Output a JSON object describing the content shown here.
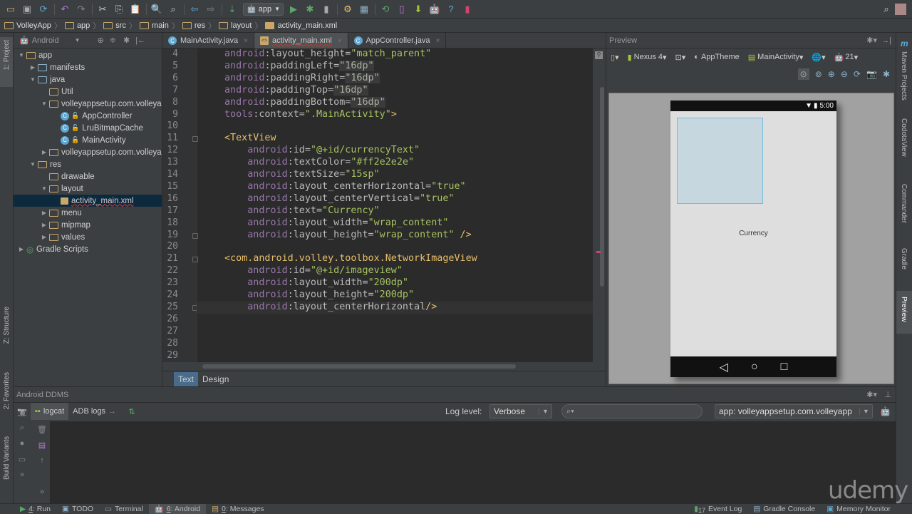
{
  "toolbar": {
    "run_config": "app",
    "icons": [
      "open-folder-icon",
      "save-icon",
      "sync-icon",
      "undo-icon",
      "redo-icon",
      "cut-icon",
      "copy-icon",
      "paste-icon",
      "find-icon",
      "replace-icon",
      "back-icon",
      "forward-icon",
      "make-project-icon",
      "run-icon",
      "debug-icon",
      "attach-debugger-icon",
      "project-structure-icon",
      "sdk-manager-icon",
      "sync-gradle-icon",
      "avd-manager-icon",
      "sdk-android-icon",
      "android-monitor-icon",
      "help-icon",
      "device-monitor-icon"
    ]
  },
  "breadcrumb": [
    "VolleyApp",
    "app",
    "src",
    "main",
    "res",
    "layout",
    "activity_main.xml"
  ],
  "project": {
    "view_mode": "Android",
    "tree": [
      {
        "label": "app",
        "depth": 0,
        "arrow": "▼",
        "icon": "module"
      },
      {
        "label": "manifests",
        "depth": 1,
        "arrow": "▶",
        "icon": "folder"
      },
      {
        "label": "java",
        "depth": 1,
        "arrow": "▼",
        "icon": "folder"
      },
      {
        "label": "Util",
        "depth": 2,
        "arrow": "",
        "icon": "package"
      },
      {
        "label": "volleyappsetup.com.volleya",
        "depth": 2,
        "arrow": "▼",
        "icon": "package"
      },
      {
        "label": "AppController",
        "depth": 3,
        "arrow": "",
        "icon": "class"
      },
      {
        "label": "LruBitmapCache",
        "depth": 3,
        "arrow": "",
        "icon": "class"
      },
      {
        "label": "MainActivity",
        "depth": 3,
        "arrow": "",
        "icon": "class"
      },
      {
        "label": "volleyappsetup.com.volleya",
        "depth": 2,
        "arrow": "▶",
        "icon": "package"
      },
      {
        "label": "res",
        "depth": 1,
        "arrow": "▼",
        "icon": "res"
      },
      {
        "label": "drawable",
        "depth": 2,
        "arrow": "",
        "icon": "package"
      },
      {
        "label": "layout",
        "depth": 2,
        "arrow": "▼",
        "icon": "package"
      },
      {
        "label": "activity_main.xml",
        "depth": 3,
        "arrow": "",
        "icon": "xml",
        "selected": true
      },
      {
        "label": "menu",
        "depth": 2,
        "arrow": "▶",
        "icon": "package"
      },
      {
        "label": "mipmap",
        "depth": 2,
        "arrow": "▶",
        "icon": "package"
      },
      {
        "label": "values",
        "depth": 2,
        "arrow": "▶",
        "icon": "package"
      },
      {
        "label": "Gradle Scripts",
        "depth": 0,
        "arrow": "▶",
        "icon": "gradle"
      }
    ]
  },
  "editor_tabs": [
    {
      "label": "MainActivity.java",
      "type": "java",
      "active": false
    },
    {
      "label": "activity_main.xml",
      "type": "xml",
      "active": true
    },
    {
      "label": "AppController.java",
      "type": "java",
      "active": false
    }
  ],
  "editor": {
    "current_line": 25,
    "lines": [
      {
        "n": "4",
        "code": "android:layout_height=\"match_parent\""
      },
      {
        "n": "5",
        "code": "android:paddingLeft=\"16dp\""
      },
      {
        "n": "6",
        "code": "android:paddingRight=\"16dp\""
      },
      {
        "n": "7",
        "code": "android:paddingTop=\"16dp\""
      },
      {
        "n": "8",
        "code": "android:paddingBottom=\"16dp\""
      },
      {
        "n": "9",
        "code": "tools:context=\".MainActivity\">"
      },
      {
        "n": "10",
        "code": ""
      },
      {
        "n": "11",
        "code": "<TextView"
      },
      {
        "n": "12",
        "code": "    android:id=\"@+id/currencyText\""
      },
      {
        "n": "13",
        "code": "    android:textColor=\"#ff2e2e2e\""
      },
      {
        "n": "14",
        "code": "    android:textSize=\"15sp\""
      },
      {
        "n": "15",
        "code": "    android:layout_centerHorizontal=\"true\""
      },
      {
        "n": "16",
        "code": "    android:layout_centerVertical=\"true\""
      },
      {
        "n": "17",
        "code": "    android:text=\"Currency\""
      },
      {
        "n": "18",
        "code": "    android:layout_width=\"wrap_content\""
      },
      {
        "n": "19",
        "code": "    android:layout_height=\"wrap_content\" />"
      },
      {
        "n": "20",
        "code": ""
      },
      {
        "n": "21",
        "code": "<com.android.volley.toolbox.NetworkImageView"
      },
      {
        "n": "22",
        "code": "    android:id=\"@+id/imageview\""
      },
      {
        "n": "23",
        "code": "    android:layout_width=\"200dp\""
      },
      {
        "n": "24",
        "code": "    android:layout_height=\"200dp\""
      },
      {
        "n": "25",
        "code": "    android:layout_centerHorizontal/>"
      },
      {
        "n": "26",
        "code": ""
      },
      {
        "n": "27",
        "code": ""
      },
      {
        "n": "28",
        "code": ""
      },
      {
        "n": "29",
        "code": ""
      }
    ],
    "mode_tabs": [
      "Text",
      "Design"
    ],
    "active_mode": "Text"
  },
  "preview": {
    "title": "Preview",
    "device": "Nexus 4",
    "theme": "AppTheme",
    "activity": "MainActivity",
    "api": "21",
    "status_time": "5:00",
    "textview_text": "Currency"
  },
  "ddms": {
    "title": "Android DDMS",
    "tabs": [
      "logcat",
      "ADB logs"
    ],
    "log_level_label": "Log level:",
    "log_level": "Verbose",
    "search_value": "",
    "app_filter": "app: volleyappsetup.com.volleyapp"
  },
  "left_stripe": [
    "1: Project",
    "Z: Structure",
    "2: Favorites",
    "Build Variants"
  ],
  "right_stripe": [
    "Maven Projects",
    "CodotaView",
    "Commander",
    "Gradle",
    "Preview"
  ],
  "bottom_tabs": {
    "left": [
      {
        "num": "4",
        "label": ": Run"
      },
      {
        "num": "",
        "label": "TODO"
      },
      {
        "num": "",
        "label": "Terminal"
      },
      {
        "num": "6",
        "label": ": Android",
        "active": true
      },
      {
        "num": "0",
        "label": ": Messages"
      }
    ],
    "right": [
      {
        "label": "Event Log",
        "badge": "17"
      },
      {
        "label": "Gradle Console"
      },
      {
        "label": "Memory Monitor"
      }
    ]
  },
  "watermark": "udemy",
  "colors": {
    "selection": "#0d293e",
    "accent": "#4a6c8c",
    "run_green": "#59a869"
  }
}
